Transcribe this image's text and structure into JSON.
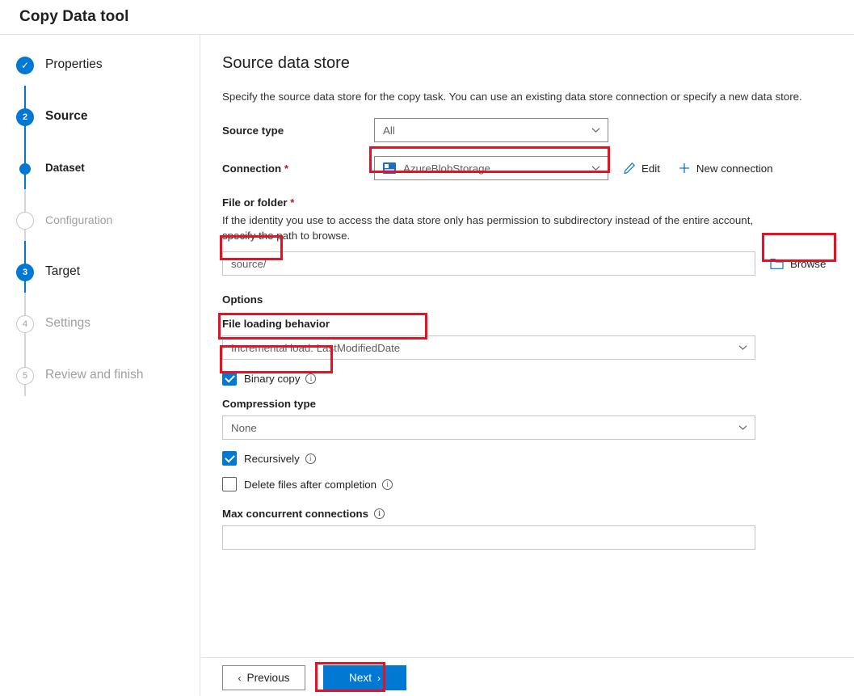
{
  "window": {
    "title": "Copy Data tool"
  },
  "sidebar": {
    "steps": [
      {
        "marker": "✓",
        "label": "Properties",
        "state": "done"
      },
      {
        "marker": "2",
        "label": "Source",
        "state": "active"
      },
      {
        "marker": "",
        "label": "Dataset",
        "state": "dot"
      },
      {
        "marker": "",
        "label": "Configuration",
        "state": "todo"
      },
      {
        "marker": "3",
        "label": "Target",
        "state": "current"
      },
      {
        "marker": "4",
        "label": "Settings",
        "state": "todo"
      },
      {
        "marker": "5",
        "label": "Review and finish",
        "state": "todo"
      }
    ]
  },
  "main": {
    "title": "Source data store",
    "description": "Specify the source data store for the copy task. You can use an existing data store connection or specify a new data store.",
    "source_type": {
      "label": "Source type",
      "value": "All"
    },
    "connection": {
      "label": "Connection",
      "required_marker": "*",
      "value": "AzureBlobStorage",
      "icon": "azure-blob-storage-icon",
      "edit_label": "Edit",
      "new_connection_label": "New connection"
    },
    "file_or_folder": {
      "label": "File or folder",
      "required_marker": "*",
      "help": "If the identity you use to access the data store only has permission to subdirectory instead of the entire account, specify the path to browse.",
      "value": "source/",
      "browse_label": "Browse"
    },
    "options": {
      "title": "Options",
      "file_loading_behavior": {
        "label": "File loading behavior",
        "value": "Incremental load: LastModifiedDate"
      },
      "binary_copy": {
        "label": "Binary copy",
        "checked": true,
        "info": "ⓘ"
      },
      "compression_type": {
        "label": "Compression type",
        "value": "None"
      },
      "recursively": {
        "label": "Recursively",
        "checked": true
      },
      "delete_files_after_completion": {
        "label": "Delete files after completion",
        "checked": false
      },
      "max_concurrent_connections": {
        "label": "Max concurrent connections",
        "value": ""
      }
    }
  },
  "footer": {
    "previous_label": "Previous",
    "previous_arrow": "‹",
    "next_label": "Next",
    "next_arrow": "›"
  },
  "colors": {
    "accent": "#0078d4",
    "annotation": "#e81123",
    "required": "#a4262c",
    "muted": "#a19f9d"
  }
}
